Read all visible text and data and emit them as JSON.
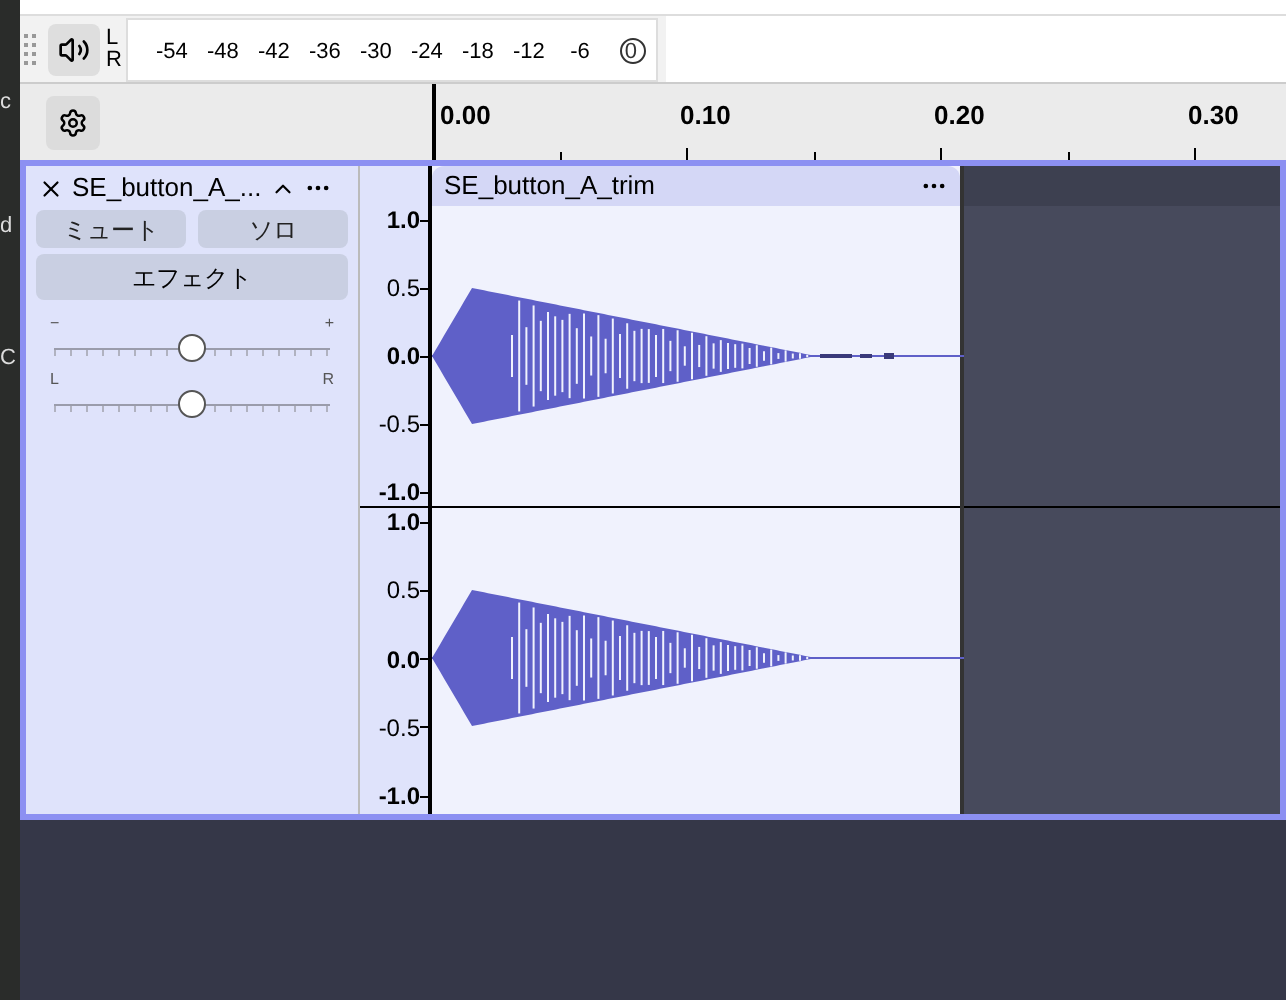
{
  "edge_labels": [
    "c",
    "d",
    "C"
  ],
  "meter": {
    "channel_labels": [
      "L",
      "R"
    ],
    "scale": [
      "-54",
      "-48",
      "-42",
      "-36",
      "-30",
      "-24",
      "-18",
      "-12",
      "-6",
      "0"
    ],
    "level": 1
  },
  "ruler": {
    "ticks": [
      "0.00",
      "0.10",
      "0.20",
      "0.30"
    ]
  },
  "track": {
    "name": "SE_button_A_...",
    "buttons": [
      {
        "label": "ミュート",
        "selected": false
      },
      {
        "label": "ソロ",
        "selected": false
      }
    ],
    "effects_button": "エフェクト",
    "gain": {
      "min_label": "−",
      "max_label": "+",
      "level": 0.5
    },
    "pan": {
      "min_label": "L",
      "max_label": "R",
      "level": 0.5
    },
    "channels": [
      {
        "axis": [
          {
            "text": "1.0",
            "major": true
          },
          {
            "text": "0.5",
            "major": false
          },
          {
            "text": "0.0",
            "major": true
          },
          {
            "text": "-0.5",
            "major": false
          },
          {
            "text": "-1.0",
            "major": true
          }
        ],
        "tail": true
      },
      {
        "axis": [
          {
            "text": "1.0",
            "major": true
          },
          {
            "text": "0.5",
            "major": false
          },
          {
            "text": "0.0",
            "major": true
          },
          {
            "text": "-0.5",
            "major": false
          },
          {
            "text": "-1.0",
            "major": true
          }
        ],
        "tail": false
      }
    ]
  },
  "clip": {
    "title": "SE_button_A_trim"
  }
}
